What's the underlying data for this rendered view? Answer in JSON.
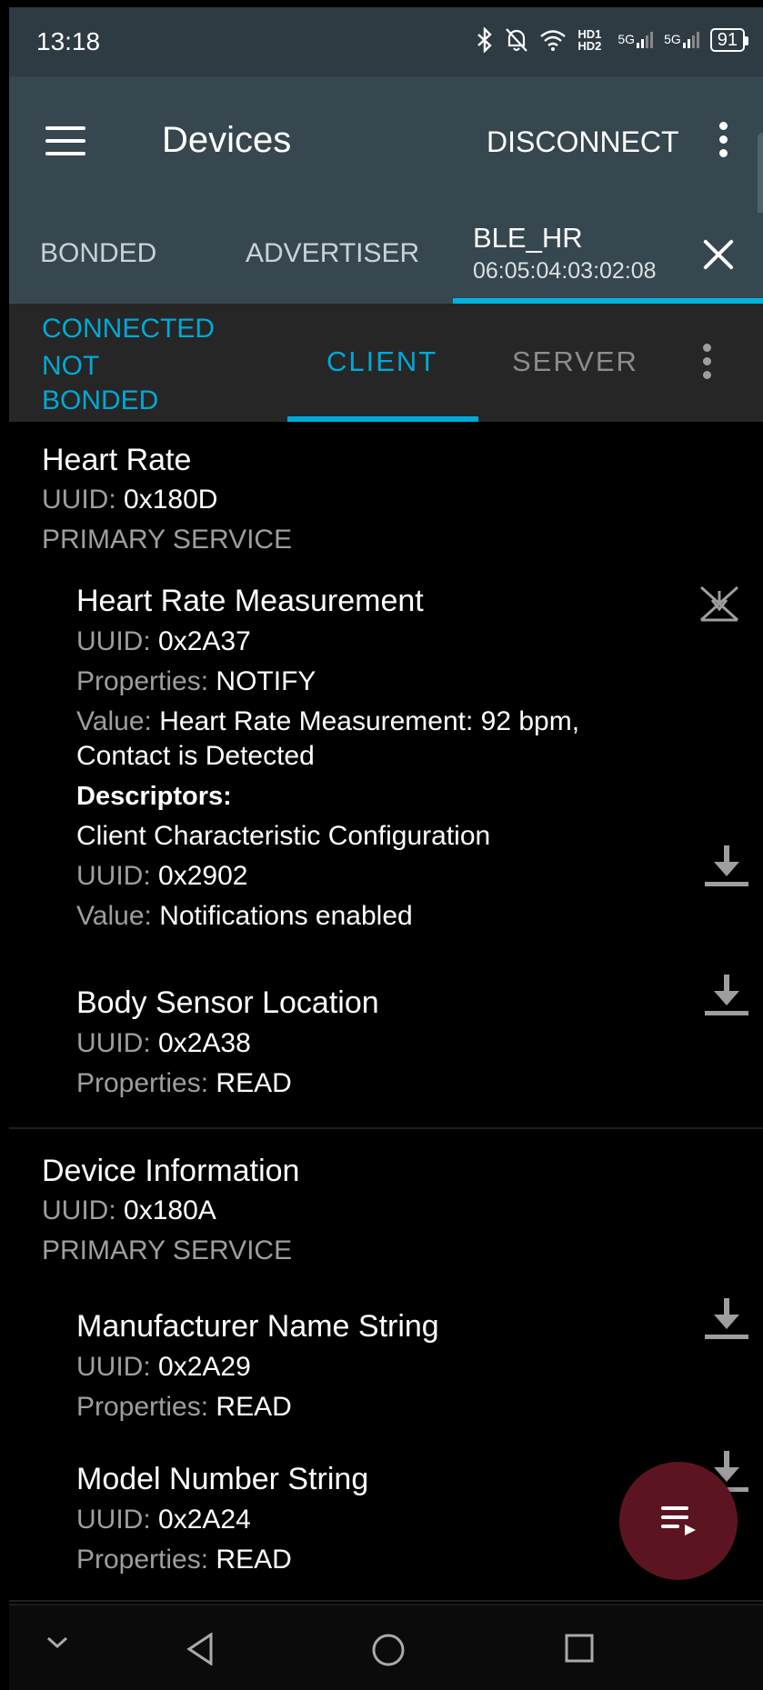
{
  "status_bar": {
    "time": "13:18",
    "network_label": "HD1 HD2",
    "signal_label_1": "5G",
    "signal_label_2": "5G",
    "battery": "91"
  },
  "toolbar": {
    "title": "Devices",
    "disconnect_label": "DISCONNECT"
  },
  "device_tabs": {
    "bonded": "BONDED",
    "advertiser": "ADVERTISER",
    "active_name": "BLE_HR",
    "active_address": "06:05:04:03:02:08"
  },
  "connection": {
    "state": "CONNECTED",
    "bond_state": "NOT BONDED",
    "client_tab": "CLIENT",
    "server_tab": "SERVER"
  },
  "labels": {
    "uuid": "UUID:",
    "properties": "Properties:",
    "value": "Value:",
    "descriptors": "Descriptors:"
  },
  "services": [
    {
      "name": "Heart Rate",
      "uuid": "0x180D",
      "type": "PRIMARY SERVICE",
      "characteristics": [
        {
          "name": "Heart Rate Measurement",
          "uuid": "0x2A37",
          "properties": "NOTIFY",
          "value_line1": "Heart Rate Measurement: 92 bpm,",
          "value_line2": "Contact is Detected",
          "descriptor": {
            "name": "Client Characteristic Configuration",
            "uuid": "0x2902",
            "value": "Notifications enabled"
          }
        },
        {
          "name": "Body Sensor Location",
          "uuid": "0x2A38",
          "properties": "READ"
        }
      ]
    },
    {
      "name": "Device Information",
      "uuid": "0x180A",
      "type": "PRIMARY SERVICE",
      "characteristics": [
        {
          "name": "Manufacturer Name String",
          "uuid": "0x2A29",
          "properties": "READ"
        },
        {
          "name": "Model Number String",
          "uuid": "0x2A24",
          "properties": "READ"
        }
      ]
    }
  ],
  "colors": {
    "accent": "#00a9d4",
    "toolbar": "#37474f",
    "fab": "#5c1520"
  }
}
